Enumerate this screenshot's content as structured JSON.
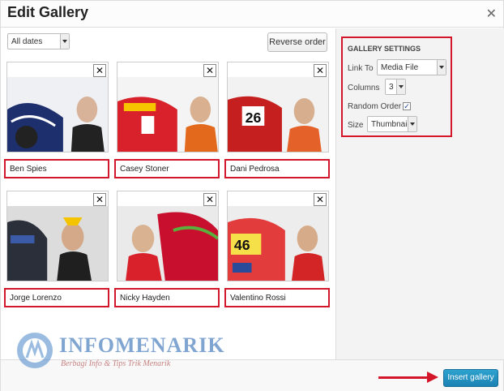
{
  "window": {
    "title": "Edit Gallery"
  },
  "toolbar": {
    "date_filter": "All dates",
    "reverse_label": "Reverse order"
  },
  "gallery": [
    {
      "name": "Ben Spies",
      "accent": "#1e2f6e"
    },
    {
      "name": "Casey Stoner",
      "accent": "#d8212b"
    },
    {
      "name": "Dani Pedrosa",
      "accent": "#e5612a"
    },
    {
      "name": "Jorge Lorenzo",
      "accent": "#2a2f3a"
    },
    {
      "name": "Nicky Hayden",
      "accent": "#c8102e"
    },
    {
      "name": "Valentino Rossi",
      "accent": "#e33c3c"
    }
  ],
  "settings": {
    "title": "GALLERY SETTINGS",
    "link_to_label": "Link To",
    "link_to_value": "Media File",
    "columns_label": "Columns",
    "columns_value": "3",
    "random_label": "Random Order",
    "random_checked": true,
    "size_label": "Size",
    "size_value": "Thumbnail"
  },
  "footer": {
    "insert_label": "Insert gallery"
  },
  "watermark": {
    "name": "INFOMENARIK",
    "tagline": "Berbagi Info & Tips Trik Menarik"
  },
  "colors": {
    "highlight": "#d4162a",
    "primary_button": "#1b82b3"
  }
}
